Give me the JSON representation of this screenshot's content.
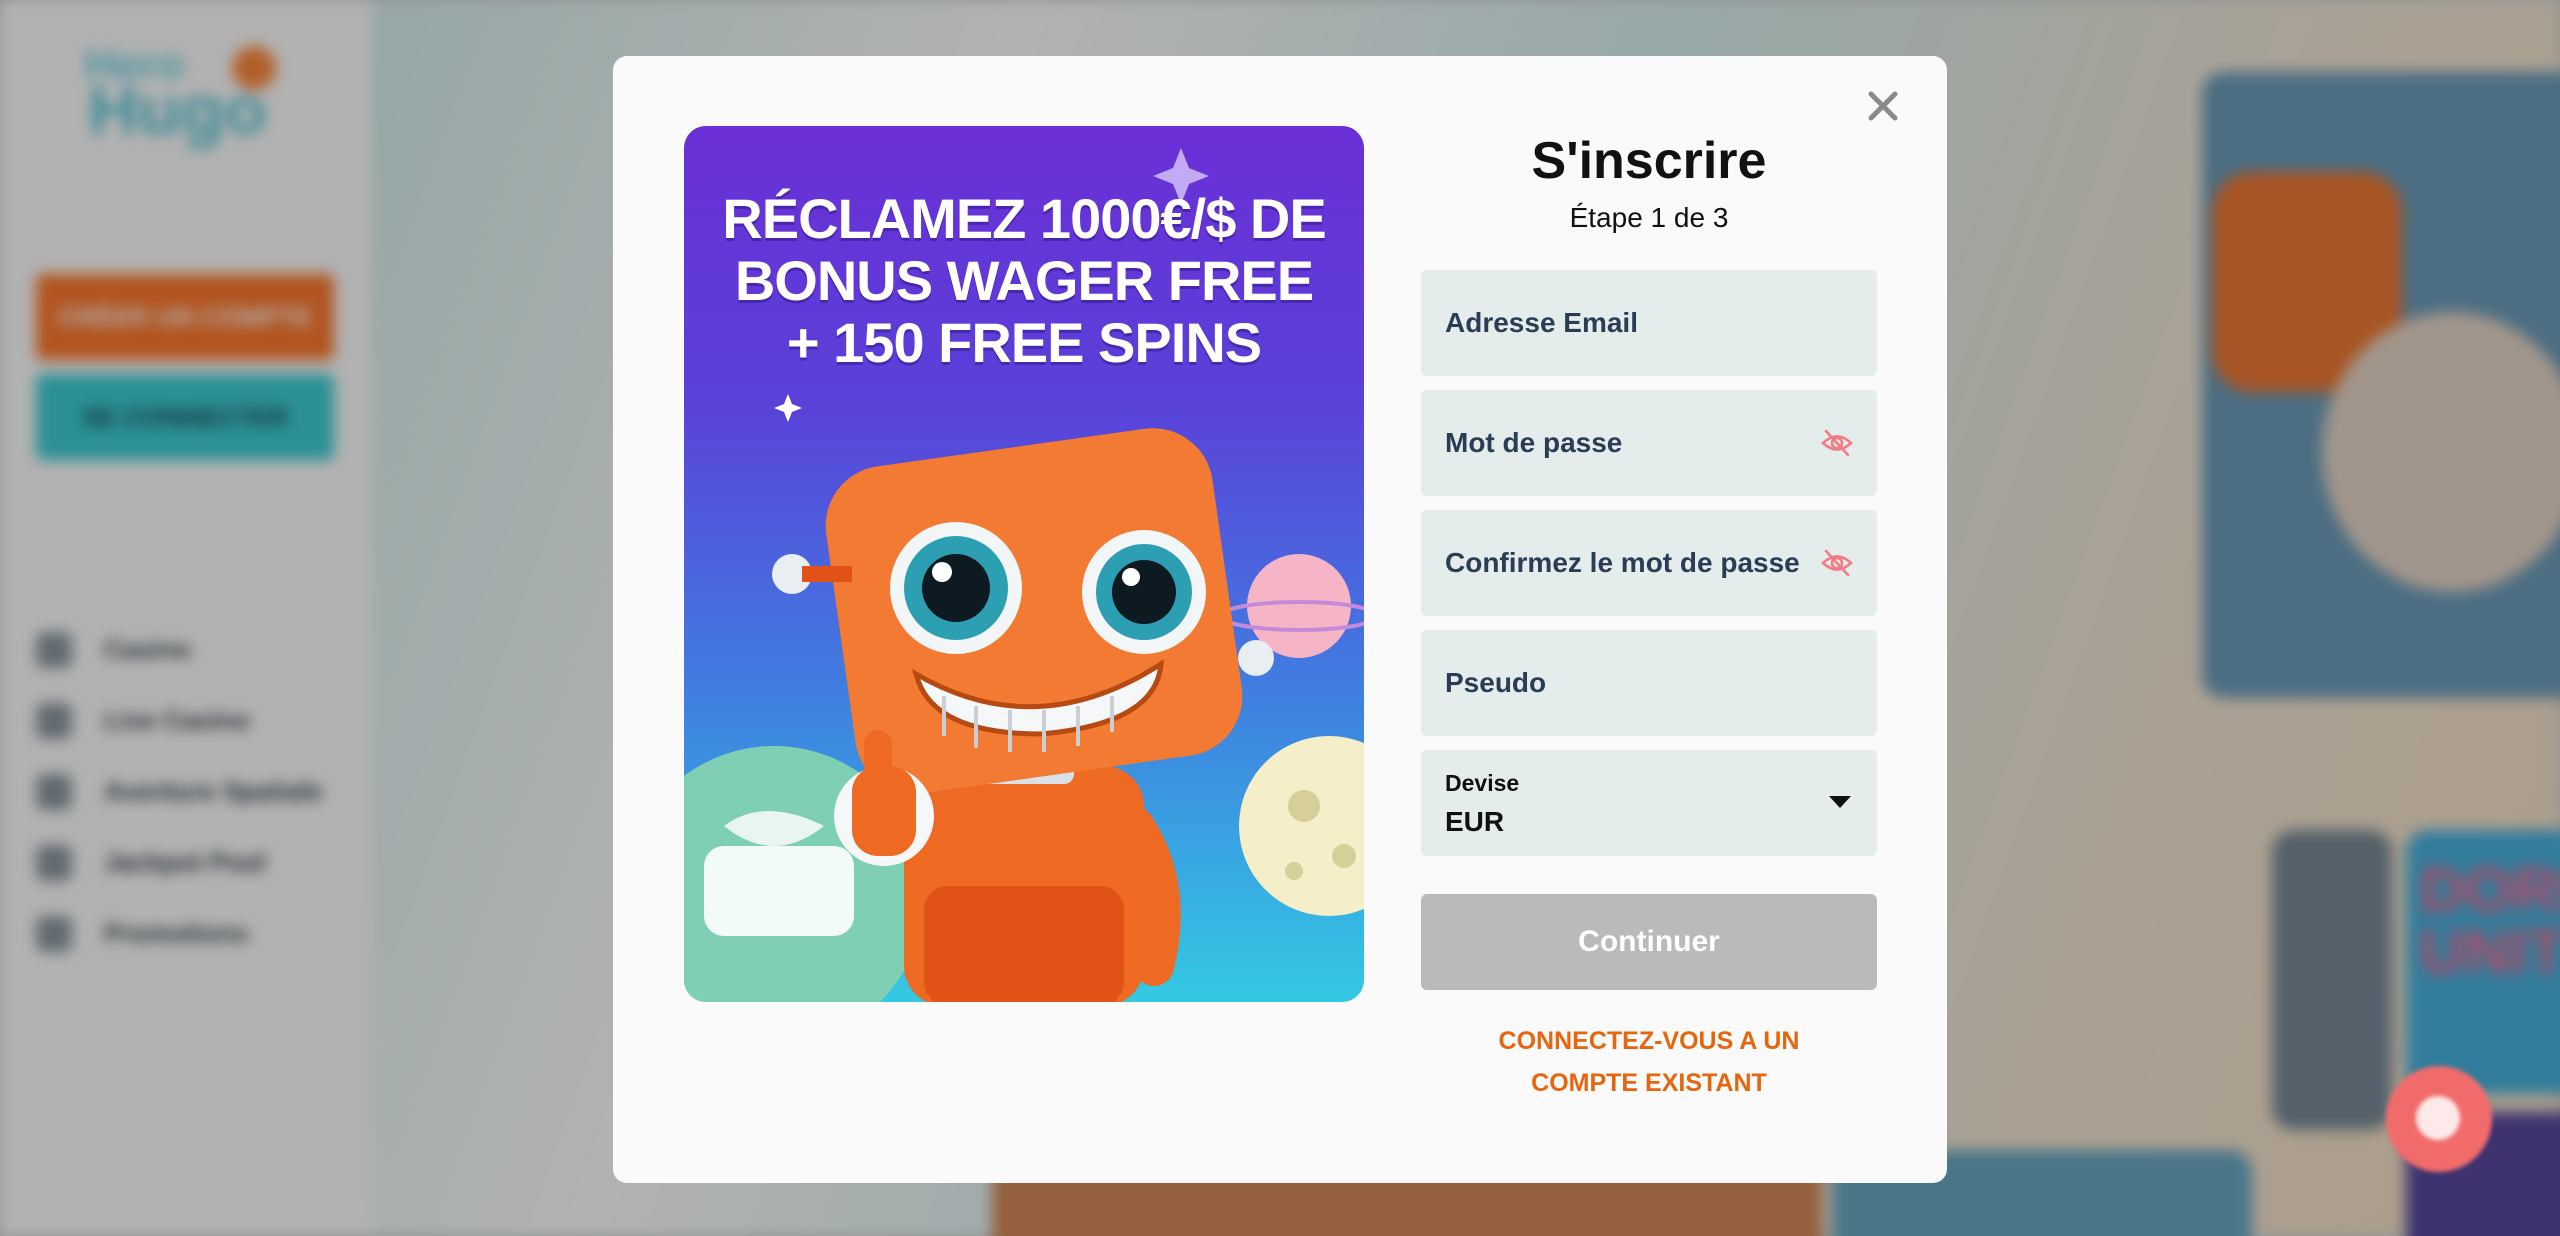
{
  "background": {
    "logo_text_top": "Hero",
    "logo_text_bottom": "Hugo",
    "sidebar_buttons": [
      "CRÉER UN COMPTE",
      "SE CONNECTER"
    ],
    "nav_items": [
      "Casino",
      "Live Casino",
      "Aventure Spatiale",
      "Jackpot Pool",
      "Promotions"
    ],
    "tile_text": "DORK UNIT"
  },
  "modal": {
    "promo_lines": [
      "RÉCLAMEZ 1000€/$ DE",
      "BONUS WAGER FREE",
      "+ 150 FREE SPINS"
    ],
    "title": "S'inscrire",
    "step": "Étape 1 de 3",
    "fields": {
      "email": "Adresse Email",
      "password": "Mot de passe",
      "confirm_password": "Confirmez le mot de passe",
      "username": "Pseudo"
    },
    "currency": {
      "label": "Devise",
      "value": "EUR"
    },
    "continue_label": "Continuer",
    "existing_account_label": "CONNECTEZ-VOUS A UN COMPTE EXISTANT"
  },
  "colors": {
    "accent_orange": "#e6650f",
    "button_disabled": "#bababa",
    "field_bg": "#e4ecec",
    "eye_icon": "#f07d86"
  }
}
